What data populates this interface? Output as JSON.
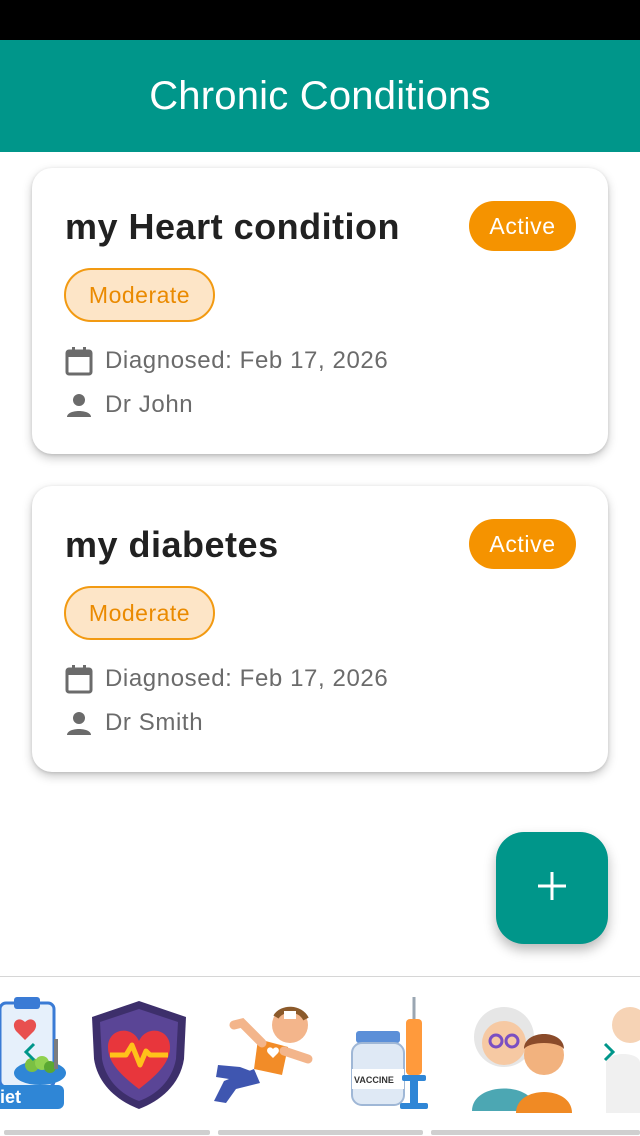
{
  "app": {
    "title": "Chronic Conditions"
  },
  "conditions": [
    {
      "name": "my Heart condition",
      "status": "Active",
      "severity": "Moderate",
      "diagnosed": "Diagnosed: Feb 17, 2026",
      "doctor": "Dr John"
    },
    {
      "name": "my diabetes",
      "status": "Active",
      "severity": "Moderate",
      "diagnosed": "Diagnosed: Feb 17, 2026",
      "doctor": "Dr Smith"
    }
  ],
  "colors": {
    "primary": "#00968a",
    "status_active": "#f59300",
    "severity_moderate_bg": "#fde5c7",
    "severity_moderate_border": "#f29a12"
  },
  "carousel": {
    "items": [
      {
        "icon": "diet-icon",
        "label": "iet"
      },
      {
        "icon": "heart-shield-icon"
      },
      {
        "icon": "falling-person-icon"
      },
      {
        "icon": "vaccine-icon",
        "label": "VACCINE"
      },
      {
        "icon": "elderly-care-icon"
      },
      {
        "icon": "doctor-icon"
      }
    ]
  },
  "icons": {
    "fab": "plus-icon",
    "date": "calendar-icon",
    "doctor": "person-icon",
    "carousel_left": "chevron-left-icon",
    "carousel_right": "chevron-right-icon"
  }
}
